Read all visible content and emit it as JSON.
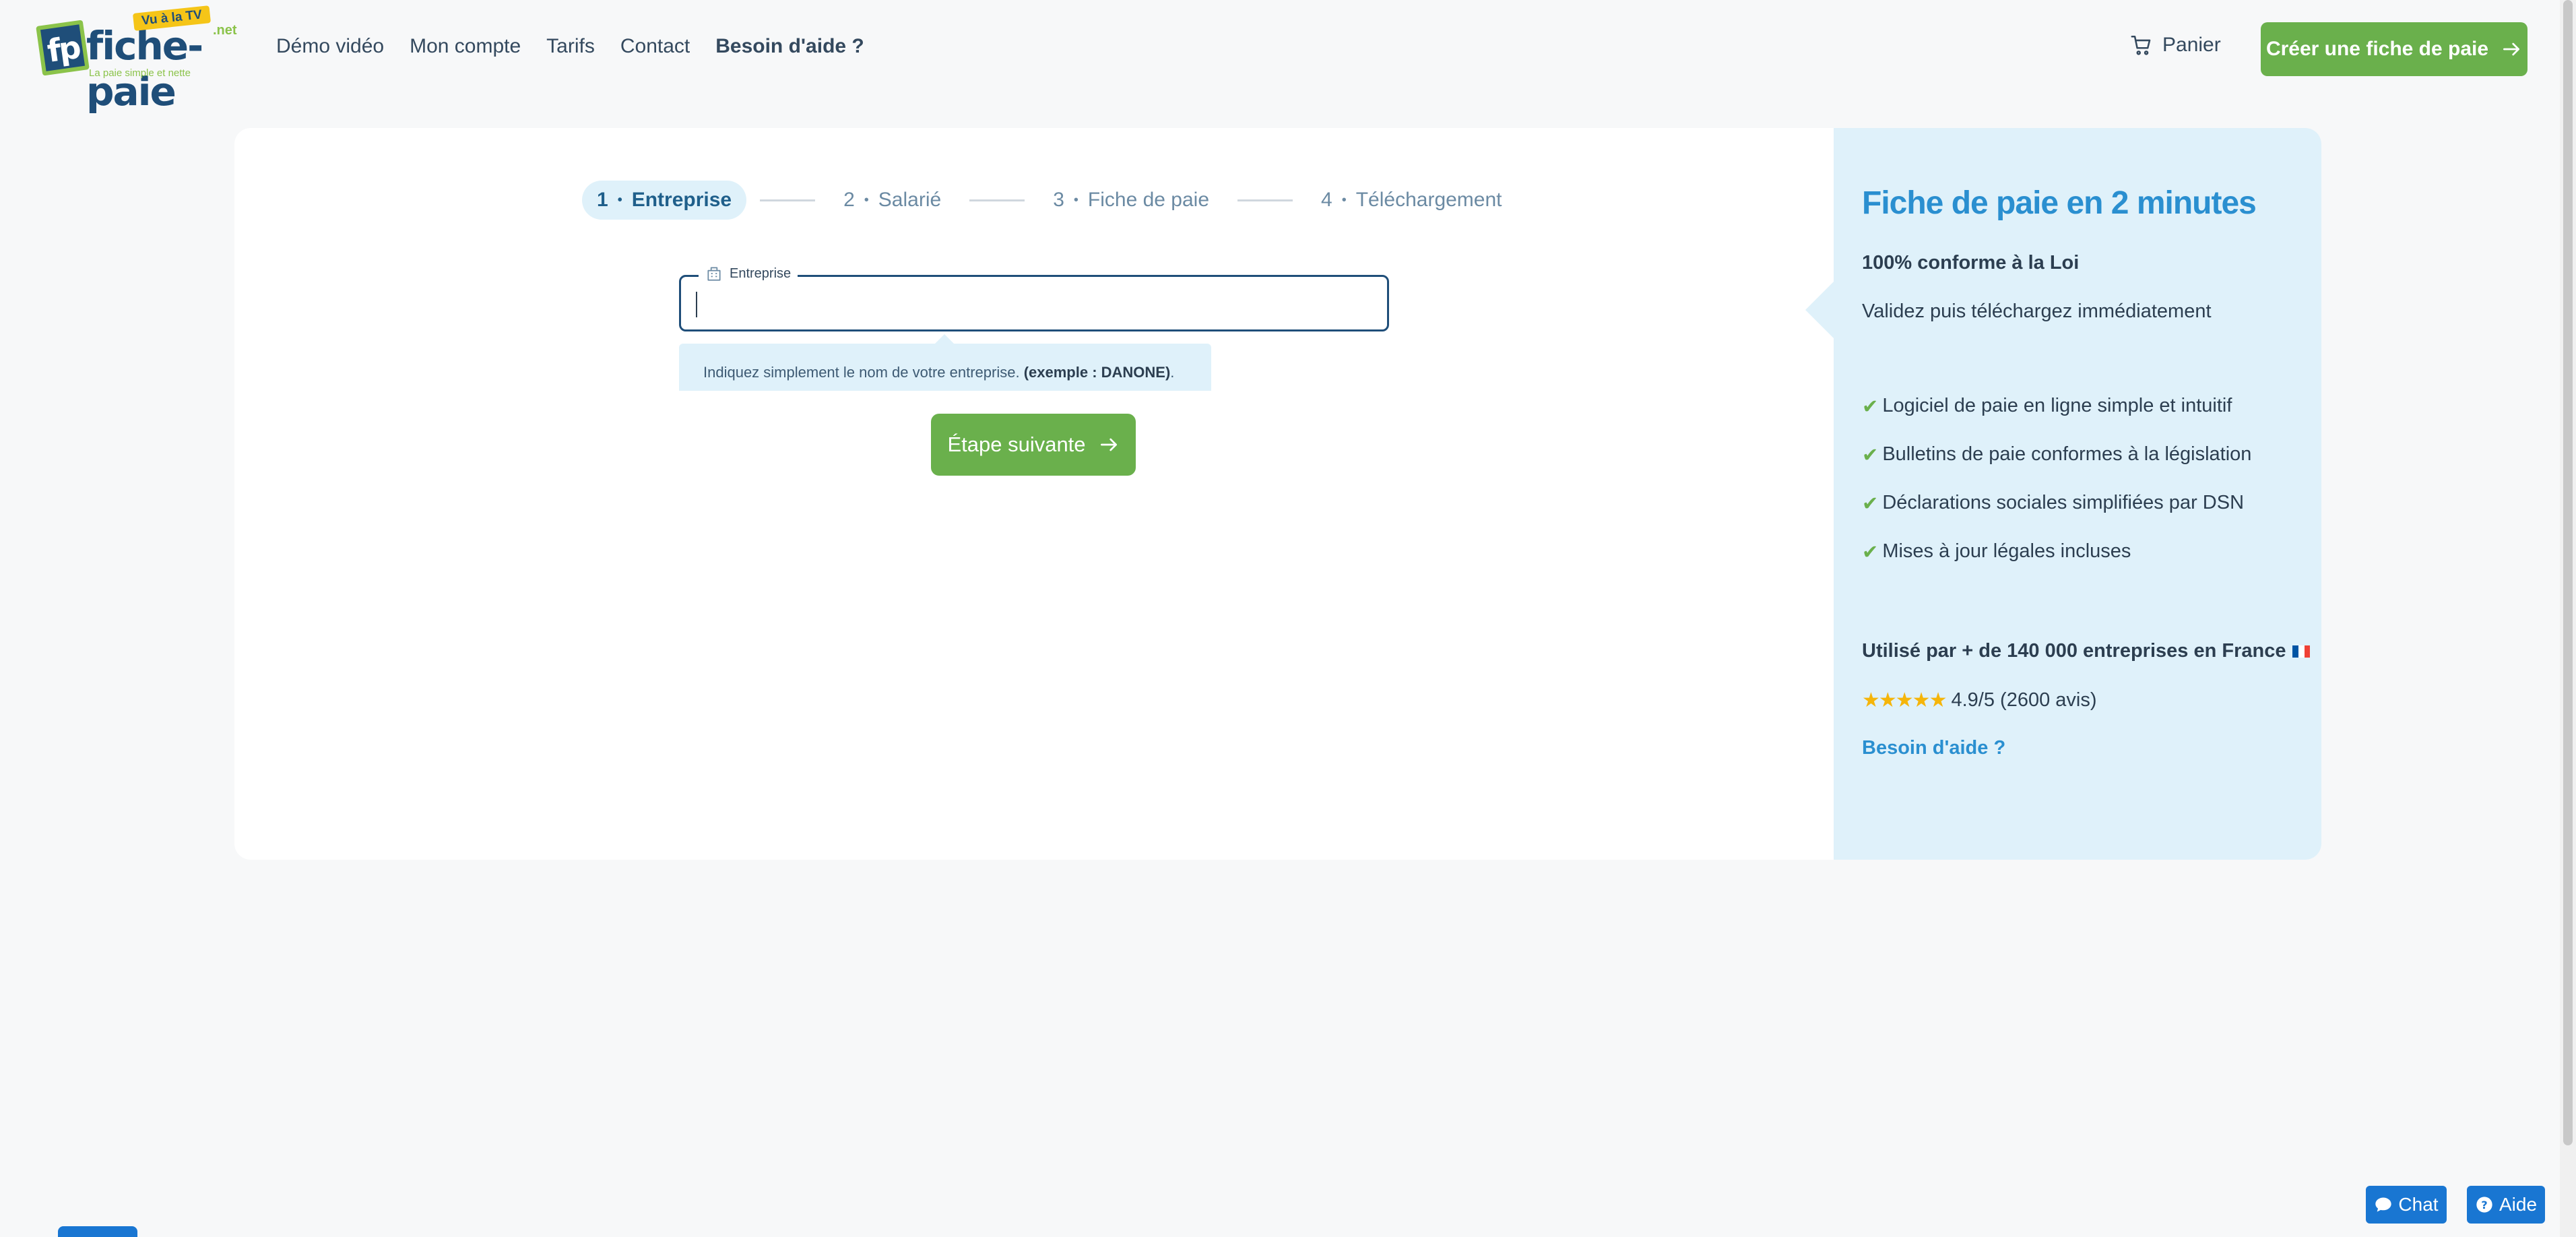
{
  "header": {
    "logo": {
      "badge": "Vu à la TV",
      "name": "fiche-paie",
      "suffix": ".net",
      "tagline": "La paie simple et nette",
      "monogram": "fp"
    },
    "nav": [
      {
        "label": "Démo vidéo"
      },
      {
        "label": "Mon compte"
      },
      {
        "label": "Tarifs"
      },
      {
        "label": "Contact"
      },
      {
        "label": "Besoin d'aide ?"
      }
    ],
    "cart_label": "Panier",
    "cta_label": "Créer une fiche de paie"
  },
  "steps": [
    {
      "number": "1",
      "label": "Entreprise",
      "active": true
    },
    {
      "number": "2",
      "label": "Salarié",
      "active": false
    },
    {
      "number": "3",
      "label": "Fiche de paie",
      "active": false
    },
    {
      "number": "4",
      "label": "Téléchargement",
      "active": false
    }
  ],
  "form": {
    "field_label": "Entreprise",
    "field_value": "",
    "hint_text": "Indiquez simplement le nom de votre entreprise.",
    "hint_example": "(exemple : DANONE)",
    "hint_end": ".",
    "next_label": "Étape suivante"
  },
  "side": {
    "title": "Fiche de paie en 2 minutes",
    "sub1": "100% conforme à la Loi",
    "sub2": "Validez puis téléchargez immédiatement",
    "check": "✔",
    "features": [
      "Logiciel de paie en ligne simple et intuitif",
      "Bulletins de paie conformes à la législation",
      "Déclarations sociales simplifiées par DSN",
      "Mises à jour légales incluses"
    ],
    "used_by": "Utilisé par + de 140 000 entreprises en France",
    "stars": "★★★★★",
    "rating": "4.9/5 (2600 avis)",
    "help": "Besoin d'aide ?"
  },
  "widgets": {
    "chat": "Chat",
    "aide": "Aide"
  },
  "colors": {
    "primary": "#6ab04c",
    "accent": "#2a8fd0",
    "panel": "#dff1fa",
    "navy": "#1f4e79",
    "widget": "#1976d2"
  }
}
